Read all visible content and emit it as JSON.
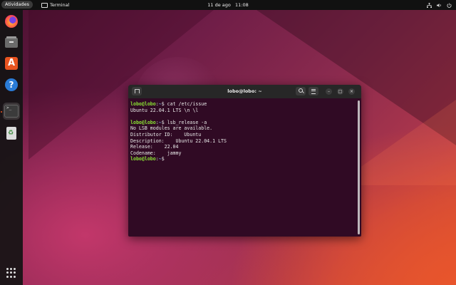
{
  "topbar": {
    "activities": "Atividades",
    "app_name": "Terminal",
    "date": "11 de ago",
    "time": "11:08",
    "tray_icons": [
      "network-icon",
      "volume-icon",
      "power-icon"
    ]
  },
  "dock": {
    "items": [
      {
        "name": "firefox",
        "icon": "firefox-icon"
      },
      {
        "name": "files",
        "icon": "files-icon"
      },
      {
        "name": "app-center",
        "icon": "app-center-icon"
      },
      {
        "name": "help",
        "icon": "help-icon"
      },
      {
        "name": "terminal",
        "icon": "terminal-icon",
        "active": true
      },
      {
        "name": "trash",
        "icon": "trash-icon"
      }
    ],
    "show_apps_icon": "app-grid-icon",
    "terminal_glyph": ">_"
  },
  "terminal": {
    "title": "lobo@lobo: ~",
    "prompt_user": "lobo@lobo",
    "prompt_path": "~",
    "lines": [
      {
        "type": "cmd",
        "text": "cat /etc/issue"
      },
      {
        "type": "out",
        "text": "Ubuntu 22.04.1 LTS \\n \\l"
      },
      {
        "type": "out",
        "text": ""
      },
      {
        "type": "cmd",
        "text": "lsb_release -a"
      },
      {
        "type": "out",
        "text": "No LSB modules are available."
      },
      {
        "type": "out",
        "text": "Distributor ID:\tUbuntu"
      },
      {
        "type": "out",
        "text": "Description:\tUbuntu 22.04.1 LTS"
      },
      {
        "type": "out",
        "text": "Release:\t22.04"
      },
      {
        "type": "out",
        "text": "Codename:\tjammy"
      },
      {
        "type": "cmd",
        "text": ""
      }
    ],
    "window_buttons": {
      "minimize": "–",
      "maximize": "□",
      "close": "×"
    }
  },
  "colors": {
    "terminal_bg": "#300a24",
    "prompt_green": "#8ae234",
    "path_blue": "#729fcf",
    "accent": "#e95420"
  }
}
